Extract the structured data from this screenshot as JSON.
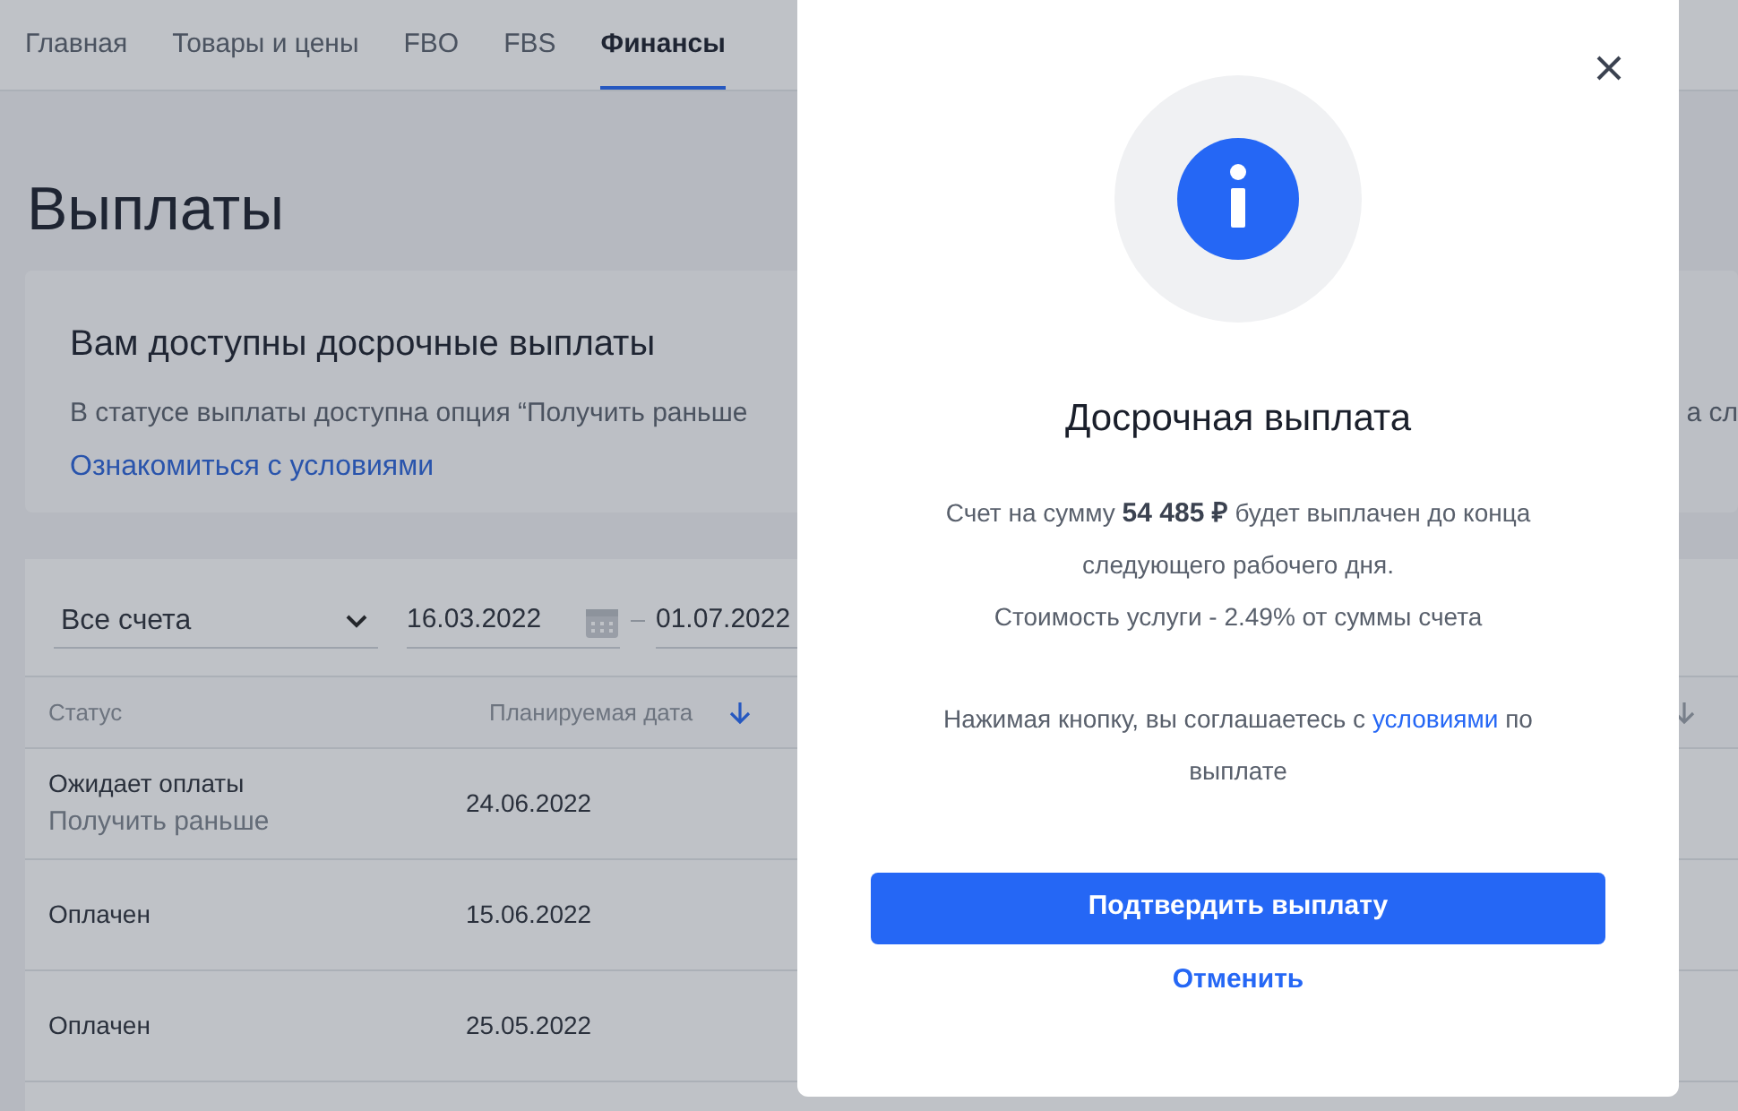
{
  "nav": {
    "tabs": [
      {
        "label": "Главная",
        "selected": false
      },
      {
        "label": "Товары и цены",
        "selected": false
      },
      {
        "label": "FBO",
        "selected": false
      },
      {
        "label": "FBS",
        "selected": false
      },
      {
        "label": "Финансы",
        "selected": true
      }
    ]
  },
  "page": {
    "title": "Выплаты"
  },
  "banner": {
    "title": "Вам доступны досрочные выплаты",
    "text": "В статусе выплаты доступна опция “Получить раньше",
    "text_right": "а сл",
    "link": "Ознакомиться с условиями"
  },
  "filters": {
    "account": {
      "value": "Все счета"
    },
    "date_from": "16.03.2022",
    "date_to": "01.07.2022"
  },
  "table": {
    "columns": [
      {
        "label": "Статус"
      },
      {
        "label": "Планируемая дата",
        "sortable": true,
        "sorted": true
      },
      {
        "sortable": true,
        "sorted": false
      }
    ],
    "rows": [
      {
        "status": "Ожидает оплаты",
        "action": "Получить раньше",
        "date": "24.06.2022"
      },
      {
        "status": "Оплачен",
        "date": "15.06.2022"
      },
      {
        "status": "Оплачен",
        "date": "25.05.2022"
      }
    ]
  },
  "modal": {
    "title": "Досрочная выплата",
    "body": "Счет на сумму **54 485 ₽** будет выплачен до конца следующего рабочего дня.",
    "fee": "Стоимость услуги - 2.49% от суммы счета",
    "consent": "Нажимая кнопку, вы соглашаетесь с",
    "consent_link": "условиями",
    "consent_end": "по выплате",
    "confirm": "Подтвердить выплату",
    "cancel": "Отменить"
  }
}
